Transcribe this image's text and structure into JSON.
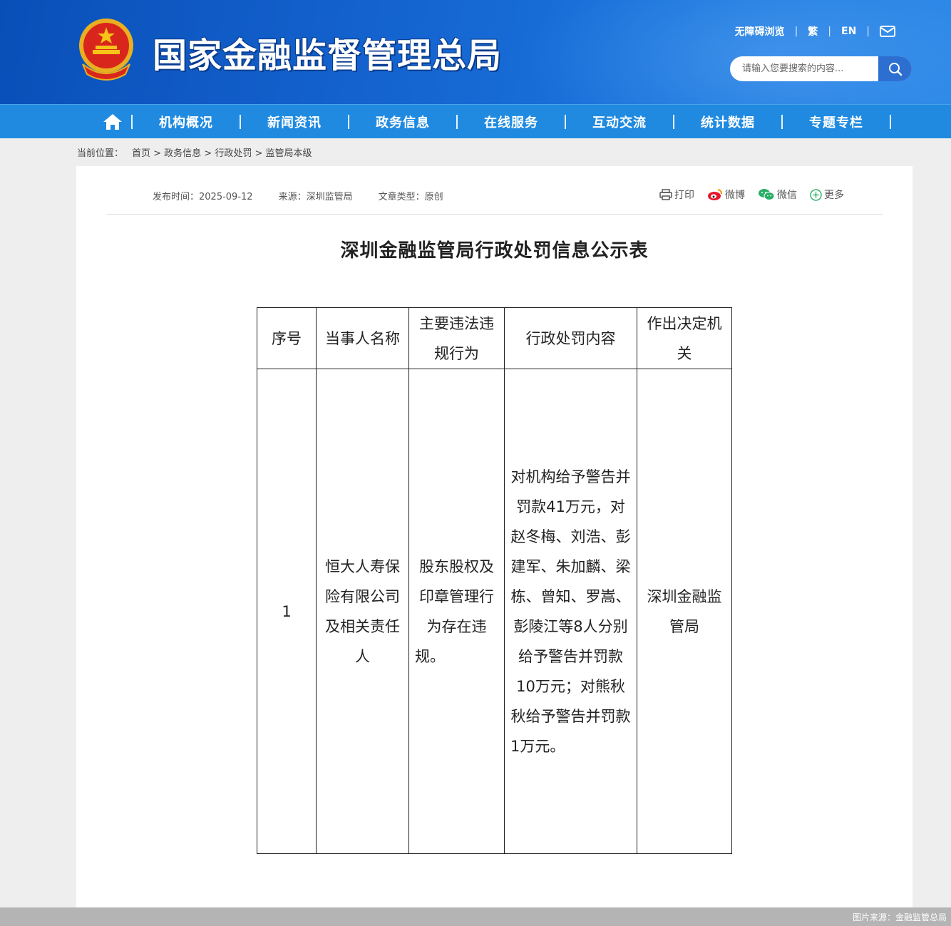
{
  "site": {
    "title": "国家金融监督管理总局",
    "top_links": [
      "无障碍浏览",
      "繁",
      "EN"
    ],
    "search_placeholder": "请输入您要搜索的内容..."
  },
  "nav": {
    "items": [
      "机构概况",
      "新闻资讯",
      "政务信息",
      "在线服务",
      "互动交流",
      "统计数据",
      "专题专栏"
    ]
  },
  "breadcrumb": {
    "label": "当前位置：",
    "path": "首页 > 政务信息 > 行政处罚 > 监管局本级"
  },
  "article": {
    "publish_time": "发布时间：2025-09-12",
    "source": "来源：深圳监管局",
    "type": "文章类型：原创",
    "share": {
      "print": "打印",
      "weibo": "微博",
      "wechat": "微信",
      "more": "更多"
    },
    "title": "深圳金融监管局行政处罚信息公示表"
  },
  "table": {
    "headers": [
      "序号",
      "当事人名称",
      "主要违法违规行为",
      "行政处罚内容",
      "作出决定机关"
    ],
    "rows": [
      {
        "no": "1",
        "party": "恒大人寿保险有限公司及相关责任人",
        "violation": "股东股权及印章管理行为存在违规。",
        "penalty": "对机构给予警告并罚款41万元，对赵冬梅、刘浩、彭建军、朱加麟、梁栋、曾知、罗嵩、彭陵江等8人分别给予警告并罚款10万元；对熊秋秋给予警告并罚款1万元。",
        "authority": "深圳金融监管局"
      }
    ]
  },
  "footer": {
    "image_source": "图片来源：金融监管总局"
  },
  "colors": {
    "header_blue": "#1463cf",
    "nav_blue": "#1f8ae0"
  }
}
